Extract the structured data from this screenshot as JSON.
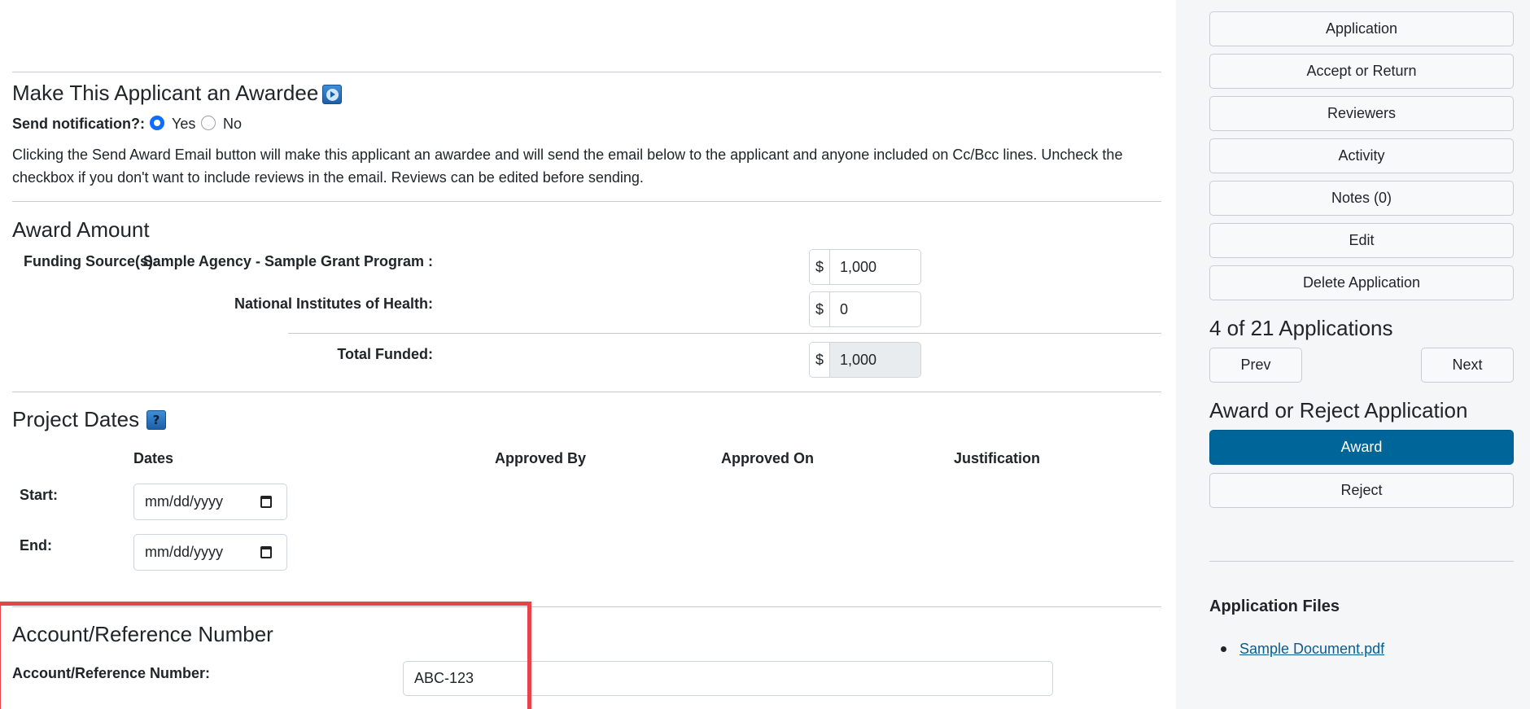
{
  "award_section": {
    "title": "Make This Applicant an Awardee",
    "send_notification_label": "Send notification?:",
    "options": [
      "Yes",
      "No"
    ],
    "selected": "Yes",
    "description": "Clicking the Send Award Email button will make this applicant an awardee and will send the email below to the applicant and anyone included on Cc/Bcc lines. Uncheck the checkbox if you don't want to include reviews in the email. Reviews can be edited before sending."
  },
  "award_amount": {
    "title": "Award Amount",
    "funding_sources_label": "Funding Source(s):",
    "currency": "$",
    "sources": [
      {
        "label": "Sample Agency - Sample Grant Program :",
        "value": "1,000"
      },
      {
        "label": "National Institutes of Health:",
        "value": "0"
      }
    ],
    "total_label": "Total Funded:",
    "total_value": "1,000"
  },
  "project_dates": {
    "title": "Project Dates",
    "columns": [
      "Dates",
      "Approved By",
      "Approved On",
      "Justification"
    ],
    "start_label": "Start:",
    "end_label": "End:",
    "date_placeholder": "mm/dd/yyyy"
  },
  "account": {
    "title": "Account/Reference Number",
    "label": "Account/Reference Number:",
    "value": "ABC-123"
  },
  "sidebar": {
    "buttons": [
      "Application",
      "Accept or Return",
      "Reviewers",
      "Activity",
      "Notes (0)",
      "Edit",
      "Delete Application"
    ],
    "counter": "4 of 21 Applications",
    "prev": "Prev",
    "next": "Next",
    "award_heading": "Award or Reject Application",
    "award": "Award",
    "reject": "Reject",
    "files_heading": "Application Files",
    "files": [
      "Sample Document.pdf"
    ]
  },
  "colors": {
    "primary": "#006699",
    "highlight": "#e8424b",
    "link": "#0a5c91"
  }
}
